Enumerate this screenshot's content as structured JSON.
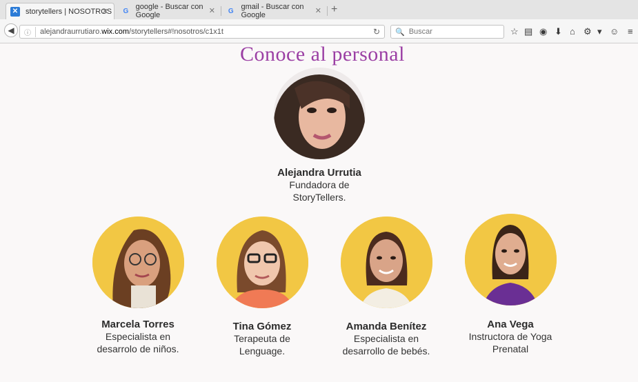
{
  "browser": {
    "tabs": [
      {
        "title": "storytellers | NOSOTROS",
        "favicon": "wix-icon",
        "active": true
      },
      {
        "title": "google - Buscar con Google",
        "favicon": "google-icon",
        "active": false
      },
      {
        "title": "gmail - Buscar con Google",
        "favicon": "google-icon",
        "active": false
      }
    ],
    "url_prefix": "alejandraurrutiaro.",
    "url_host": "wix.com",
    "url_path": "/storytellers#!nosotros/c1x1t",
    "search_placeholder": "Buscar"
  },
  "page": {
    "title": "Conoce al personal",
    "founder": {
      "name": "Alejandra Urrutia",
      "role": "Fundadora de StoryTellers."
    },
    "team": [
      {
        "name": "Marcela Torres",
        "role": "Especialista en desarrolo de niños."
      },
      {
        "name": "Tina Gómez",
        "role": "Terapeuta de Lenguage."
      },
      {
        "name": "Amanda Benítez",
        "role": "Especialista en desarrollo de bebés."
      },
      {
        "name": "Ana Vega",
        "role": "Instructora de Yoga Prenatal"
      }
    ]
  },
  "colors": {
    "title": "#9b3fa4",
    "avatar_bg": "#f2c744"
  }
}
